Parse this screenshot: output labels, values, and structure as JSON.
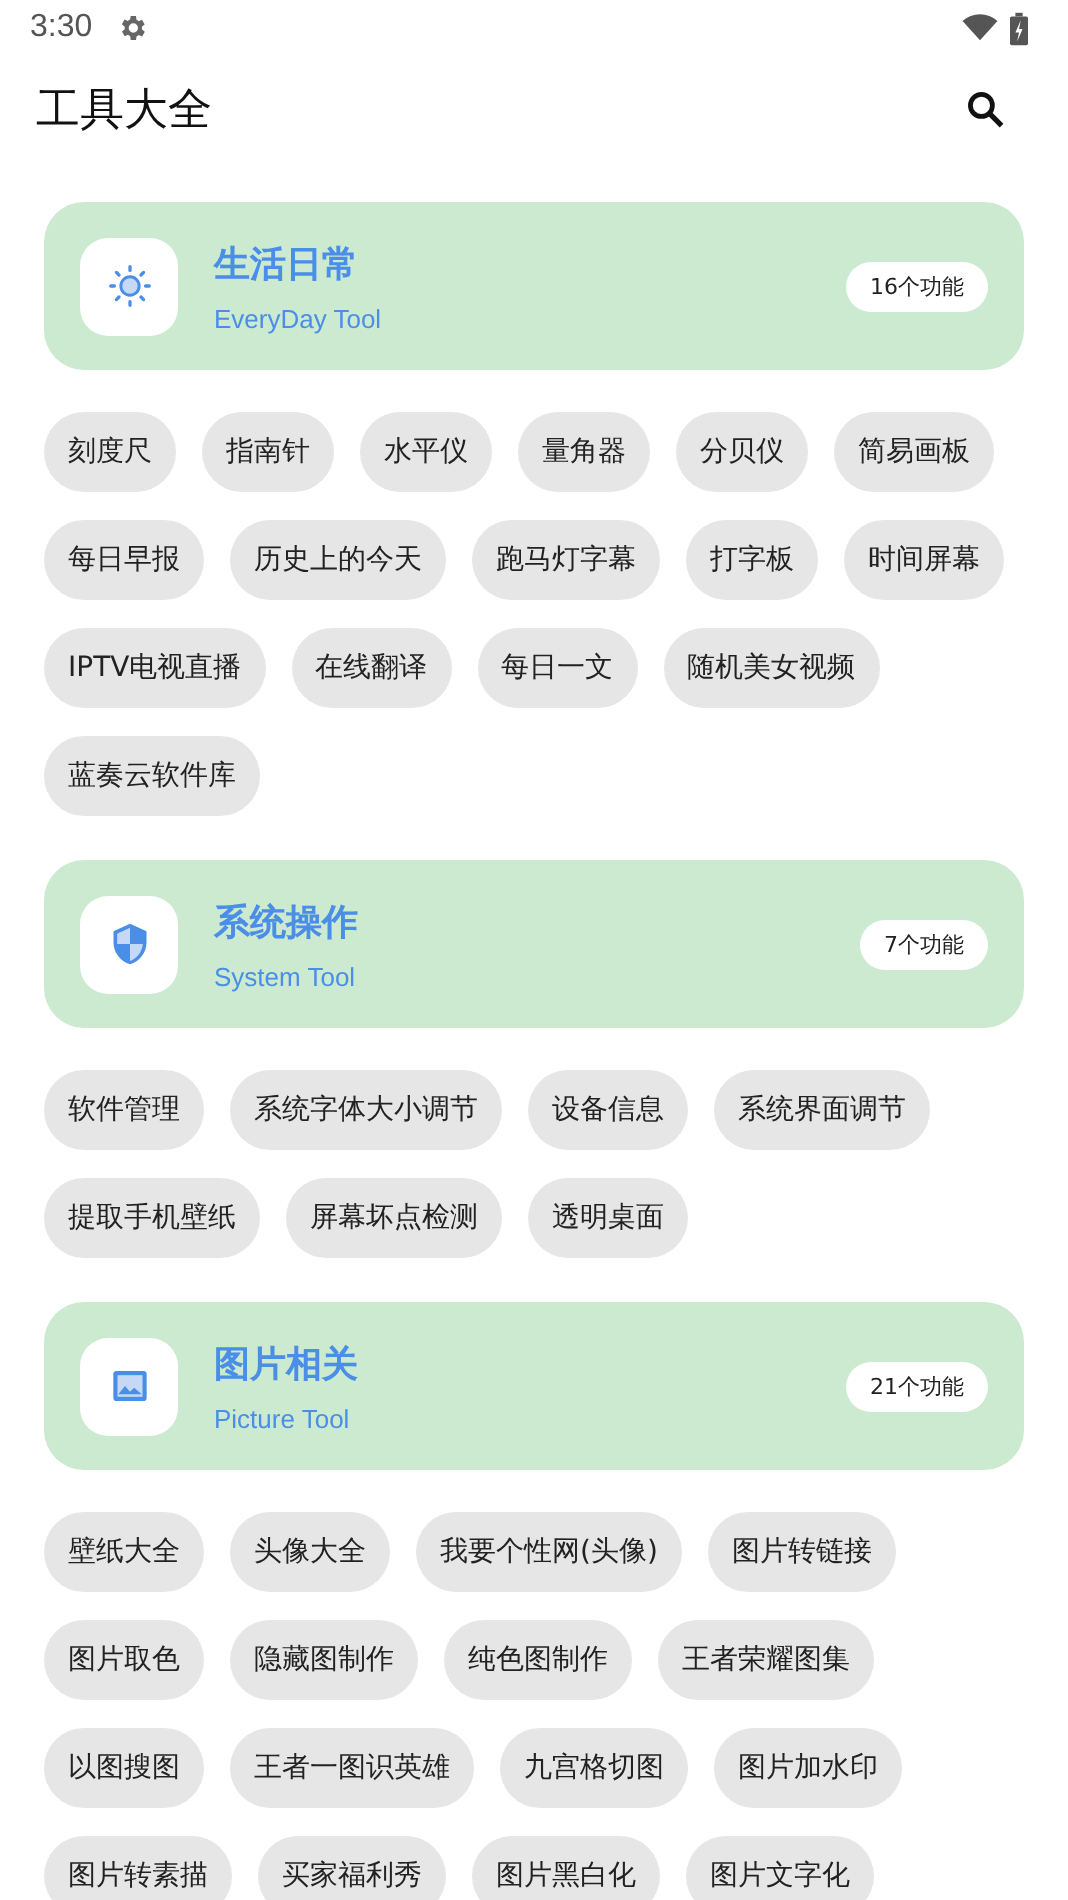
{
  "status_bar": {
    "time": "3:30"
  },
  "app_bar": {
    "title": "工具大全"
  },
  "sections": [
    {
      "kind": "sun",
      "title": "生活日常",
      "subtitle": "EveryDay Tool",
      "count": "16个功能",
      "tools": [
        "刻度尺",
        "指南针",
        "水平仪",
        "量角器",
        "分贝仪",
        "简易画板",
        "每日早报",
        "历史上的今天",
        "跑马灯字幕",
        "打字板",
        "时间屏幕",
        "IPTV电视直播",
        "在线翻译",
        "每日一文",
        "随机美女视频",
        "蓝奏云软件库"
      ]
    },
    {
      "kind": "shield",
      "title": "系统操作",
      "subtitle": "System Tool",
      "count": "7个功能",
      "tools": [
        "软件管理",
        "系统字体大小调节",
        "设备信息",
        "系统界面调节",
        "提取手机壁纸",
        "屏幕坏点检测",
        "透明桌面"
      ]
    },
    {
      "kind": "image",
      "title": "图片相关",
      "subtitle": "Picture Tool",
      "count": "21个功能",
      "tools": [
        "壁纸大全",
        "头像大全",
        "我要个性网(头像)",
        "图片转链接",
        "图片取色",
        "隐藏图制作",
        "纯色图制作",
        "王者荣耀图集",
        "以图搜图",
        "王者一图识英雄",
        "九宫格切图",
        "图片加水印",
        "图片转素描",
        "买家福利秀",
        "图片黑白化",
        "图片文字化"
      ]
    }
  ]
}
